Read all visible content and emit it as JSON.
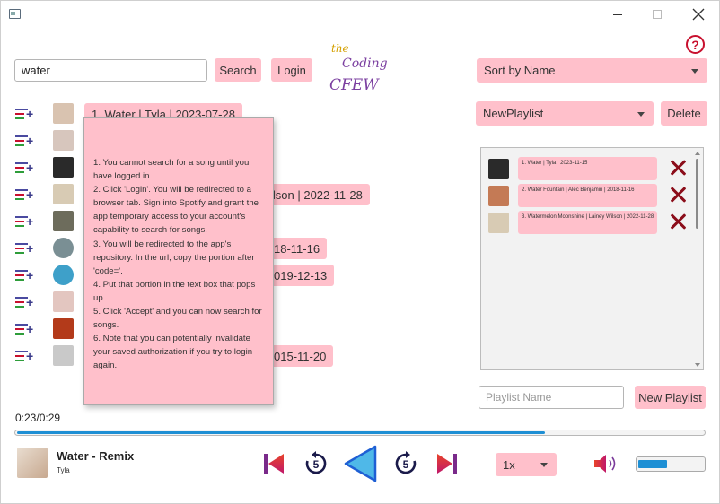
{
  "search": {
    "value": "water",
    "button_label": "Search"
  },
  "login_label": "Login",
  "logo": {
    "line1": "the",
    "line2": "Coding",
    "line3": "CFEW"
  },
  "sort": {
    "selected": "Sort by Name"
  },
  "playlist_select": {
    "selected": "NewPlaylist",
    "delete_label": "Delete"
  },
  "results": [
    {
      "label": "1. Water | Tyla | 2023-07-28",
      "thumb_color": "#d9c3b0"
    },
    {
      "label": "",
      "thumb_color": "#d7c6bd"
    },
    {
      "label": "",
      "thumb_color": "#2a2a2a"
    },
    {
      "label": "ilson | 2022-11-28",
      "thumb_color": "#d8cbb4"
    },
    {
      "label": "",
      "thumb_color": "#6d6c5c"
    },
    {
      "label": "18-11-16",
      "thumb_color": "#7a8f94"
    },
    {
      "label": "019-12-13",
      "thumb_color": "#3ea0c9"
    },
    {
      "label": "",
      "thumb_color": "#e3c6c0"
    },
    {
      "label": "",
      "thumb_color": "#b33a1a"
    },
    {
      "label": "015-11-20",
      "thumb_color": "#c9c9c9"
    }
  ],
  "help_tooltip": {
    "lines": [
      "1. You cannot search for a song until you have logged in.",
      "2. Click 'Login'. You will be redirected to a browser tab. Sign into Spotify and grant the app temporary access to your account's capability to search for songs.",
      "3. You will be redirected to the app's repository. In the url, copy the portion after 'code='.",
      "4. Put that portion in the text box that pops up.",
      "5. Click 'Accept' and you can now search for songs.",
      "6. Note that you can potentially invalidate your saved authorization if you try to login again."
    ]
  },
  "playlist_items": [
    {
      "label": "1. Water | Tyla | 2023-11-15",
      "thumb_color": "#2a2a2a"
    },
    {
      "label": "2. Water Fountain | Alec Benjamin | 2018-11-16",
      "thumb_color": "#c47a55"
    },
    {
      "label": "3. Watermelon Moonshine | Lainey Wilson | 2022-11-28",
      "thumb_color": "#d8cbb4"
    }
  ],
  "new_playlist": {
    "placeholder": "Playlist Name",
    "button_label": "New Playlist"
  },
  "player": {
    "time": "0:23/0:29",
    "progress": 0.77,
    "title": "Water - Remix",
    "artist": "Tyla",
    "speed": "1x",
    "volume": 0.45,
    "colors": {
      "accent": "#1e8fd4",
      "pink": "#ffc0cb",
      "play": "#1e8fd4"
    }
  }
}
